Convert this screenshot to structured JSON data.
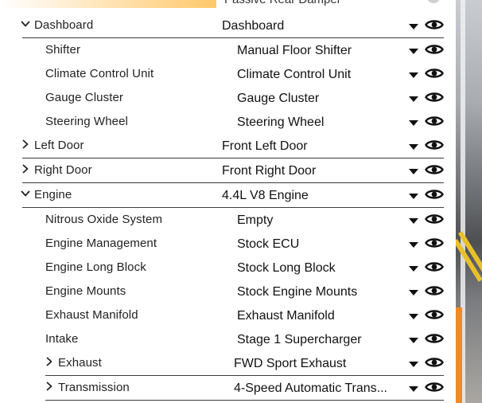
{
  "top_partial": {
    "value": "Passive Rear Damper"
  },
  "rows": [
    {
      "label": "Dashboard",
      "value": "Dashboard",
      "expander": "chevron-down"
    },
    {
      "label": "Shifter",
      "value": "Manual Floor Shifter",
      "expander": "none"
    },
    {
      "label": "Climate Control Unit",
      "value": "Climate Control Unit",
      "expander": "none"
    },
    {
      "label": "Gauge Cluster",
      "value": "Gauge Cluster",
      "expander": "none"
    },
    {
      "label": "Steering Wheel",
      "value": "Steering Wheel",
      "expander": "none"
    },
    {
      "label": "Left Door",
      "value": "Front Left Door",
      "expander": "chevron-right"
    },
    {
      "label": "Right Door",
      "value": "Front Right Door",
      "expander": "chevron-right"
    },
    {
      "label": "Engine",
      "value": "4.4L V8 Engine",
      "expander": "chevron-down"
    },
    {
      "label": "Nitrous Oxide System",
      "value": "Empty",
      "expander": "none"
    },
    {
      "label": "Engine Management",
      "value": "Stock ECU",
      "expander": "none"
    },
    {
      "label": "Engine Long Block",
      "value": "Stock Long Block",
      "expander": "none"
    },
    {
      "label": "Engine Mounts",
      "value": "Stock Engine Mounts",
      "expander": "none"
    },
    {
      "label": "Exhaust Manifold",
      "value": "Exhaust Manifold",
      "expander": "none"
    },
    {
      "label": "Intake",
      "value": "Stage 1 Supercharger",
      "expander": "none"
    },
    {
      "label": "Exhaust",
      "value": "FWD Sport Exhaust",
      "expander": "chevron-right"
    },
    {
      "label": "Transmission",
      "value": "4-Speed Automatic Trans...",
      "expander": "chevron-right"
    }
  ],
  "icons": {
    "dropdown": "caret-down-icon",
    "visibility": "eye-icon"
  },
  "colors": {
    "text": "#1a1a1a",
    "separator": "#3c3c3c",
    "accent_orange": "#f08a24"
  }
}
